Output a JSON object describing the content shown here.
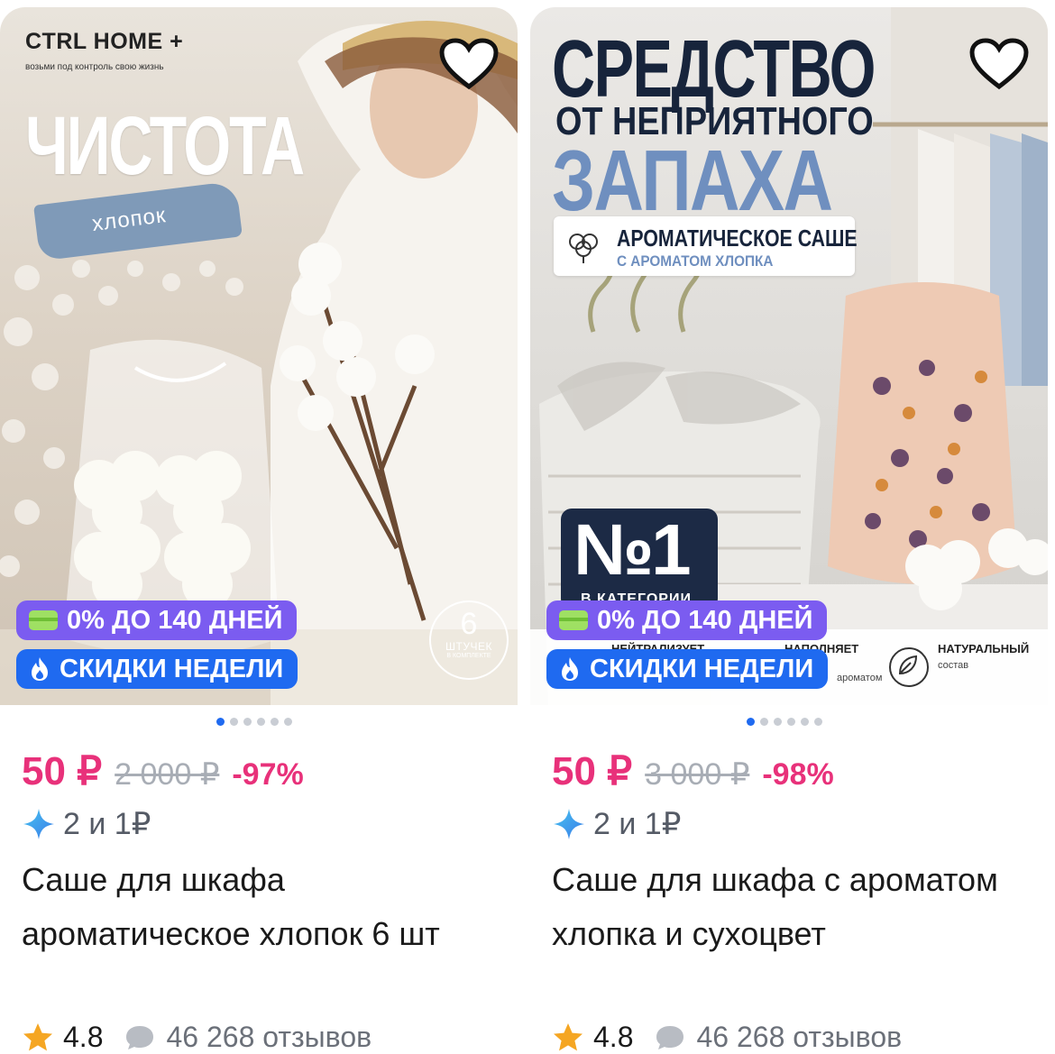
{
  "products": [
    {
      "image": {
        "brand": "CTRL HOME +",
        "brand_tagline": "возьми под контроль свою жизнь",
        "headline": "ЧИСТОТА",
        "brush_label": "хлопок",
        "count_number": "6",
        "count_unit": "ШТУЧЕК",
        "count_note": "В КОМПЛЕКТЕ"
      },
      "badges": {
        "installment": "0% ДО 140 ДНЕЙ",
        "sale": "СКИДКИ НЕДЕЛИ"
      },
      "carousel": {
        "total": 6,
        "active": 1
      },
      "price": "50 ₽",
      "old_price": "2 000 ₽",
      "discount": "-97%",
      "offer": "2 и 1₽",
      "title": "Саше для шкафа ароматическое хлопок 6 шт",
      "rating": "4.8",
      "reviews": "46 268 отзывов"
    },
    {
      "image": {
        "headline_1": "СРЕДСТВО",
        "headline_2": "ОТ НЕПРИЯТНОГО",
        "headline_3": "ЗАПАХА",
        "label_title": "АРОМАТИЧЕСКОЕ САШЕ",
        "label_subtitle": "С АРОМАТОМ ХЛОПКА",
        "rank_number": "№1",
        "rank_caption": "В КАТЕГОРИИ",
        "feature_1": "НЕЙТРАЛИЗУЕТ",
        "feature_2": "НАПОЛНЯЕТ",
        "feature_2_sub": "ароматом",
        "feature_3": "НАТУРАЛЬНЫЙ",
        "feature_3_sub": "состав"
      },
      "badges": {
        "installment": "0% ДО 140 ДНЕЙ",
        "sale": "СКИДКИ НЕДЕЛИ"
      },
      "carousel": {
        "total": 6,
        "active": 1
      },
      "price": "50 ₽",
      "old_price": "3 000 ₽",
      "discount": "-98%",
      "offer": "2 и 1₽",
      "title": "Саше для шкафа с ароматом хлопка и сухоцвет",
      "rating": "4.8",
      "reviews": "46 268 отзывов"
    }
  ],
  "icons": [
    "heart-icon",
    "card-icon",
    "fire-icon",
    "sparkle-icon",
    "star-icon",
    "comment-icon",
    "cotton-icon",
    "leaf-icon"
  ],
  "colors": {
    "price": "#e8317a",
    "installment_badge": "#7b5cf0",
    "sale_badge": "#1f6af0",
    "active_dot": "#1f6af0",
    "star": "#f5a623"
  }
}
